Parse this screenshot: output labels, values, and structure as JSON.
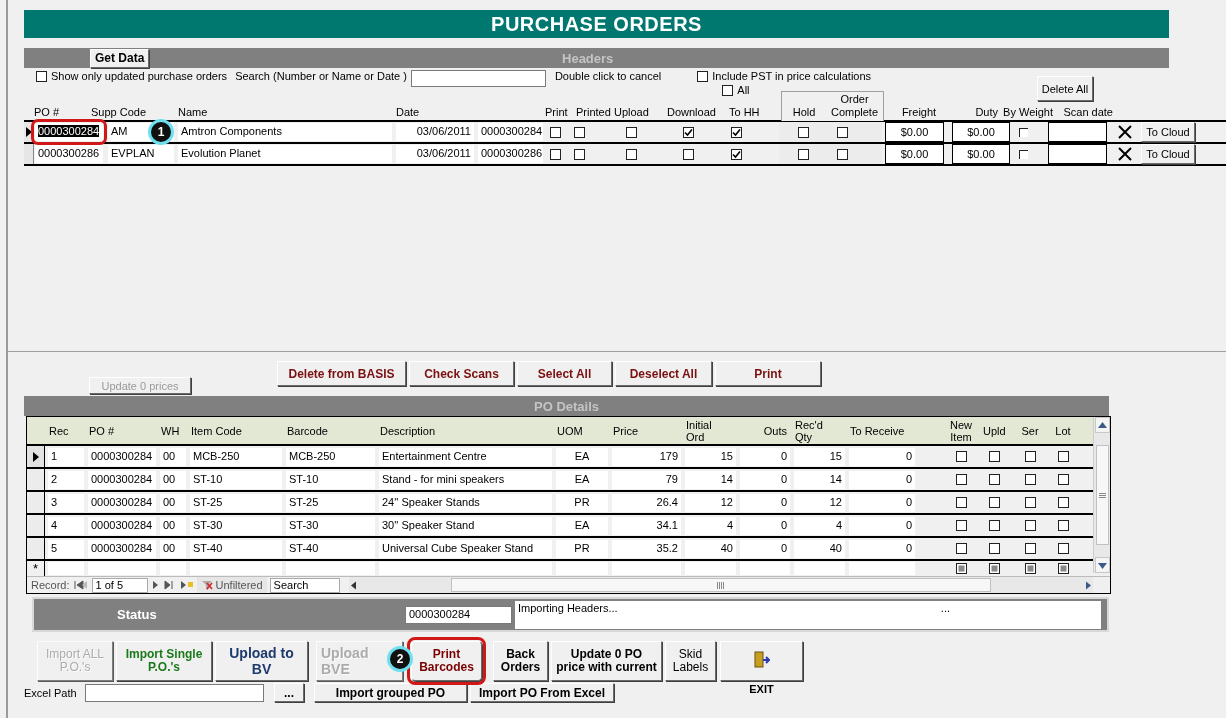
{
  "window": {
    "title": "PURCHASE ORDERS"
  },
  "headers": {
    "title": "Headers",
    "get_data": "Get Data",
    "show_updated": {
      "label": "Show only updated purchase orders",
      "checked": false
    },
    "search_label": "Search (Number or Name or Date )",
    "cancel_hint": "Double click to cancel",
    "include_pst": {
      "label": "Include PST in price calculations",
      "checked": false
    },
    "all": {
      "label": "All",
      "checked": false
    },
    "delete_all": "Delete All",
    "columns": [
      "PO #",
      "Supp Code",
      "Name",
      "Date",
      "Print",
      "Printed",
      "Upload",
      "Download",
      "To HH",
      "Hold",
      "Order Complete",
      "Freight",
      "Duty",
      "By Weight",
      "Scan date"
    ],
    "rows": [
      {
        "selected": true,
        "highlighted": true,
        "callout": "1",
        "po": "0000300284",
        "supp_code": "AM",
        "name": "Amtron Components",
        "date": "03/06/2011",
        "po_ref": "0000300284",
        "print": false,
        "printed": false,
        "upload": false,
        "download": true,
        "to_hh": true,
        "hold": false,
        "order_complete": false,
        "freight": "$0.00",
        "duty": "$0.00",
        "by_weight": false,
        "cloud_button": "To Cloud"
      },
      {
        "selected": false,
        "highlighted": false,
        "po": "0000300286",
        "supp_code": "EVPLAN",
        "name": "Evolution Planet",
        "date": "03/06/2011",
        "po_ref": "0000300286",
        "print": false,
        "printed": false,
        "upload": false,
        "download": false,
        "to_hh": true,
        "hold": false,
        "order_complete": false,
        "freight": "$0.00",
        "duty": "$0.00",
        "by_weight": false,
        "cloud_button": "To Cloud"
      }
    ]
  },
  "details": {
    "title": "PO Details",
    "update_prices": {
      "label": "Update 0 prices",
      "disabled": true
    },
    "actions": [
      "Delete from BASIS",
      "Check Scans",
      "Select All",
      "Deselect All",
      "Print"
    ],
    "columns": [
      "Rec",
      "PO #",
      "WH",
      "Item Code",
      "Barcode",
      "Description",
      "UOM",
      "Price",
      "Initial Ord",
      "Outs",
      "Rec'd Qty",
      "To Receive",
      "New Item",
      "Upld",
      "Ser",
      "Lot"
    ],
    "rows": [
      {
        "selected": true,
        "rec": "1",
        "po": "0000300284",
        "wh": "00",
        "item_code": "MCB-250",
        "barcode": "MCB-250",
        "description": "Entertainment Centre",
        "uom": "EA",
        "price": "179",
        "initial_ord": "15",
        "outs": "0",
        "recd_qty": "15",
        "to_receive": "0",
        "new_item": false,
        "upld": false,
        "ser": false,
        "lot": false
      },
      {
        "selected": false,
        "rec": "2",
        "po": "0000300284",
        "wh": "00",
        "item_code": "ST-10",
        "barcode": "ST-10",
        "description": "Stand - for mini speakers",
        "uom": "EA",
        "price": "79",
        "initial_ord": "14",
        "outs": "0",
        "recd_qty": "14",
        "to_receive": "0",
        "new_item": false,
        "upld": false,
        "ser": false,
        "lot": false
      },
      {
        "selected": false,
        "rec": "3",
        "po": "0000300284",
        "wh": "00",
        "item_code": "ST-25",
        "barcode": "ST-25",
        "description": "24'' Speaker Stands",
        "uom": "PR",
        "price": "26.4",
        "initial_ord": "12",
        "outs": "0",
        "recd_qty": "12",
        "to_receive": "0",
        "new_item": false,
        "upld": false,
        "ser": false,
        "lot": false
      },
      {
        "selected": false,
        "rec": "4",
        "po": "0000300284",
        "wh": "00",
        "item_code": "ST-30",
        "barcode": "ST-30",
        "description": "30'' Speaker Stand",
        "uom": "EA",
        "price": "34.1",
        "initial_ord": "4",
        "outs": "0",
        "recd_qty": "4",
        "to_receive": "0",
        "new_item": false,
        "upld": false,
        "ser": false,
        "lot": false
      },
      {
        "selected": false,
        "rec": "5",
        "po": "0000300284",
        "wh": "00",
        "item_code": "ST-40",
        "barcode": "ST-40",
        "description": "Universal Cube Speaker Stand",
        "uom": "PR",
        "price": "35.2",
        "initial_ord": "40",
        "outs": "0",
        "recd_qty": "40",
        "to_receive": "0",
        "new_item": false,
        "upld": false,
        "ser": false,
        "lot": false
      }
    ],
    "new_row_marker": "*",
    "navigator": {
      "label": "Record:",
      "position": "1 of 5",
      "filter": "Unfiltered",
      "search_placeholder": "Search"
    }
  },
  "status": {
    "label": "Status",
    "po": "0000300284",
    "message": "Importing Headers...",
    "extra": "..."
  },
  "actions": [
    {
      "kind": "plain",
      "label": "Import ALL\nP.O.'s",
      "disabled": true,
      "highlighted": false
    },
    {
      "kind": "import",
      "label": "Import Single\nP.O.'s",
      "disabled": false,
      "highlighted": false
    },
    {
      "kind": "upload",
      "label": "Upload to\nBV",
      "disabled": false,
      "highlighted": false
    },
    {
      "kind": "upload",
      "label": "Upload\nBVE",
      "disabled": true,
      "highlighted": false,
      "callout": "2"
    },
    {
      "kind": "alert",
      "label": "Print\nBarcodes",
      "disabled": false,
      "highlighted": true
    },
    {
      "kind": "action",
      "label": "Back\nOrders",
      "disabled": false,
      "highlighted": false
    },
    {
      "kind": "action",
      "label": "Update 0 PO\nprice with current",
      "disabled": false,
      "highlighted": false
    },
    {
      "kind": "plain",
      "label": "Skid\nLabels",
      "disabled": false,
      "highlighted": false
    },
    {
      "kind": "exit",
      "label": "EXIT",
      "disabled": false,
      "highlighted": false
    }
  ],
  "excel": {
    "label": "Excel Path",
    "browse": "...",
    "import_grouped": "Import grouped PO",
    "import_excel": "Import PO From Excel"
  }
}
